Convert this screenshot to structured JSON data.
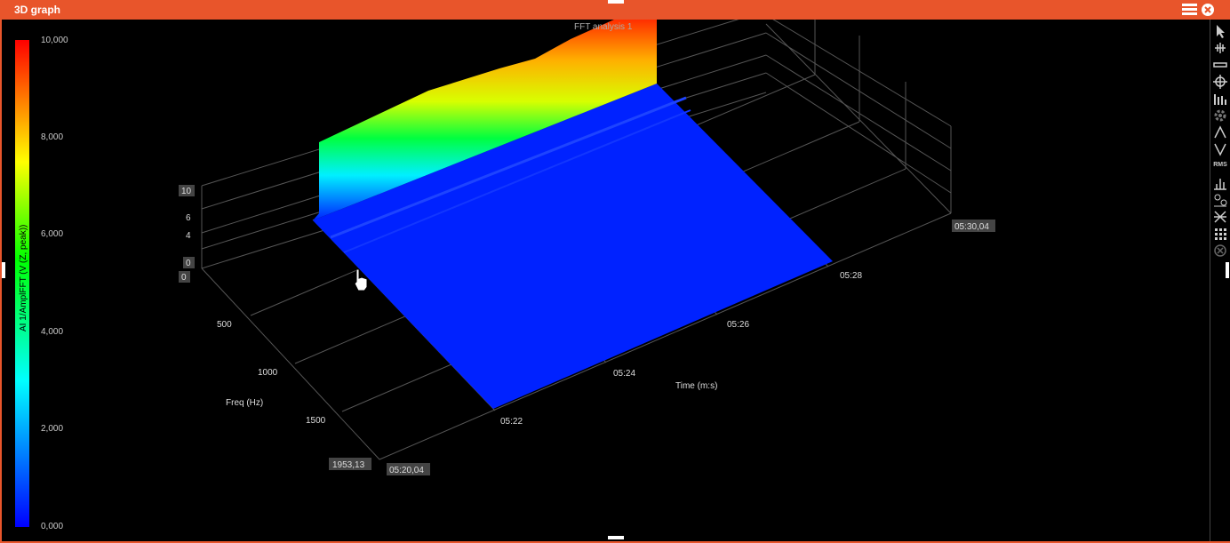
{
  "window": {
    "title": "3D graph"
  },
  "icons": {
    "menu": "hamburger-menu-icon",
    "close": "close-circle-icon"
  },
  "colorbar": {
    "label": "AI 1/AmplFFT (V (Z, peak))",
    "ticks": [
      "10,000",
      "8,000",
      "6,000",
      "4,000",
      "2,000",
      "0,000"
    ]
  },
  "chart_data": {
    "type": "surface",
    "title": "FFT analysis 1",
    "xlabel": "Time (m:s)",
    "ylabel": "Freq (Hz)",
    "zlabel": "AI 1/AmplFFT (V (Z, peak))",
    "time_ticks": [
      "05:22",
      "05:24",
      "05:26",
      "05:28"
    ],
    "time_range": [
      "05:20,04",
      "05:30,04"
    ],
    "freq_ticks": [
      500,
      1000,
      1500
    ],
    "freq_max_label": "1953,13",
    "z_ticks": [
      "10",
      "6",
      "4"
    ],
    "z_min_labels": [
      "0",
      "0"
    ],
    "zlim": [
      0,
      10
    ],
    "colorscale_range": [
      0,
      10000
    ]
  },
  "toolbar": [
    {
      "name": "pointer-icon"
    },
    {
      "name": "cursor-icon"
    },
    {
      "name": "band-icon"
    },
    {
      "name": "crosshair-icon"
    },
    {
      "name": "bars-icon"
    },
    {
      "name": "gear-icon"
    },
    {
      "name": "peak-up-icon"
    },
    {
      "name": "peak-down-icon"
    },
    {
      "name": "rms-icon",
      "label": "RMS"
    },
    {
      "name": "histogram-icon"
    },
    {
      "name": "harmonics-icon"
    },
    {
      "name": "cut-icon"
    },
    {
      "name": "grid-icon"
    },
    {
      "name": "clear-icon"
    }
  ]
}
